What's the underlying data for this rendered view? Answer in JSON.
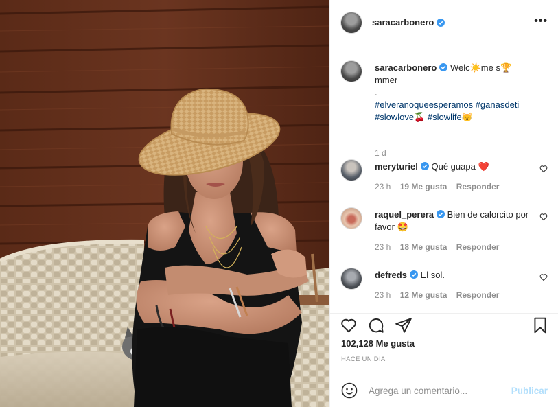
{
  "post": {
    "username": "saracarbonero",
    "caption_line1": "Welc☀️me s🏆",
    "caption_line2": "mmer",
    "caption_line3": ".",
    "hashtags_line1": "#elveranoqueesperamos #ganasdeti",
    "hashtags_line2a": "#slowlove🍒",
    "hashtags_line2b": "#slowlife😺",
    "age": "1 d"
  },
  "comments": [
    {
      "user": "meryturiel",
      "text": "Qué guapa ❤️",
      "time": "23 h",
      "likes": "19 Me gusta",
      "reply": "Responder"
    },
    {
      "user": "raquel_perera",
      "text": "Bien de calorcito por favor 🤩",
      "time": "23 h",
      "likes": "18 Me gusta",
      "reply": "Responder"
    },
    {
      "user": "defreds",
      "text": "El sol.",
      "time": "23 h",
      "likes": "12 Me gusta",
      "reply": "Responder"
    }
  ],
  "actions": {
    "likes_count": "102,128 Me gusta",
    "posted_when": "HACE UN DÍA"
  },
  "add_comment": {
    "placeholder": "Agrega un comentario...",
    "publish_label": "Publicar"
  },
  "icons": {
    "more": "more-options-icon",
    "verified": "verified-badge-icon",
    "heart": "heart-icon",
    "comment": "comment-icon",
    "share": "share-icon",
    "save": "bookmark-icon",
    "emoji": "emoji-icon"
  },
  "colors": {
    "verified_blue": "#3897f0",
    "hashtag": "#00376b",
    "publish_disabled": "#b2dffc",
    "muted": "#8e8e8e"
  }
}
